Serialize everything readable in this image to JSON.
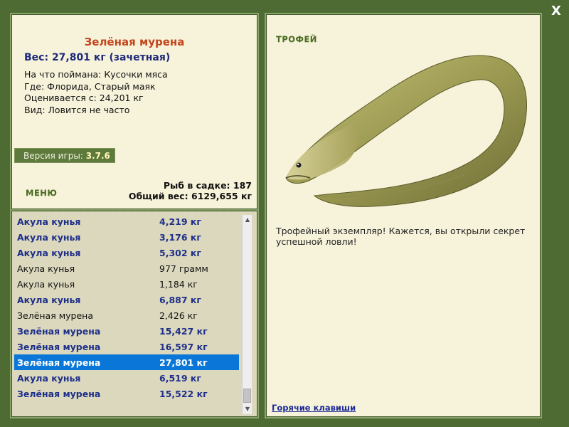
{
  "close_label": "X",
  "fish": {
    "title": "Зелёная мурена",
    "weight_line": "Вес: 27,801 кг (зачетная)",
    "info": [
      "На что поймана: Кусочки мяса",
      "Где: Флорида, Старый маяк",
      "Оценивается с: 24,201 кг",
      "Вид: Ловится не часто"
    ]
  },
  "version": {
    "label": "Версия игры:",
    "value": "3.7.6"
  },
  "menu_label": "МЕНЮ",
  "stats": {
    "fish_count": "Рыб в садке: 187",
    "total_weight": "Общий вес: 6129,655 кг"
  },
  "catch_list": [
    {
      "name": "Акула кунья",
      "weight": "4,219 кг",
      "bold": true
    },
    {
      "name": "Акула кунья",
      "weight": "3,176 кг",
      "bold": true
    },
    {
      "name": "Акула кунья",
      "weight": "5,302 кг",
      "bold": true
    },
    {
      "name": "Акула кунья",
      "weight": "977 грамм",
      "bold": false
    },
    {
      "name": "Акула кунья",
      "weight": "1,184 кг",
      "bold": false
    },
    {
      "name": "Акула кунья",
      "weight": "6,887 кг",
      "bold": true
    },
    {
      "name": "Зелёная мурена",
      "weight": "2,426 кг",
      "bold": false
    },
    {
      "name": "Зелёная мурена",
      "weight": "15,427 кг",
      "bold": true
    },
    {
      "name": "Зелёная мурена",
      "weight": "16,597 кг",
      "bold": true
    },
    {
      "name": "Зелёная мурена",
      "weight": "27,801 кг",
      "bold": true,
      "selected": true
    },
    {
      "name": "Акула кунья",
      "weight": "6,519 кг",
      "bold": true
    },
    {
      "name": "Зелёная мурена",
      "weight": "15,522 кг",
      "bold": true
    }
  ],
  "trophy": {
    "label": "ТРОФЕЙ",
    "text": "Трофейный экземпляр! Кажется, вы открыли секрет успешной ловли!"
  },
  "hotkeys_label": "Горячие клавиши",
  "colors": {
    "background": "#4e6b34",
    "panel": "#f7f3da",
    "list_bg": "#dcd8bd",
    "title": "#c3461c",
    "highlight": "#0a77d8",
    "bold_text": "#1e2f8a"
  },
  "icons": {
    "close": "close-icon",
    "eel": "green-moray-eel-image"
  }
}
